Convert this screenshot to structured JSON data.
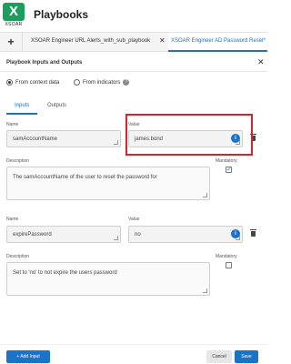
{
  "app": {
    "logo_letter": "X",
    "logo_text": "XSOAR",
    "title": "Playbooks",
    "brand_color": "#1d9e5f"
  },
  "tabs": {
    "add_label": "+",
    "items": [
      {
        "label": "XSOAR Engineer URL Alerts_with_sub_playbook",
        "close": "✕"
      },
      {
        "label": "XSOAR Engineer AD Password Reset*"
      }
    ]
  },
  "panel": {
    "title": "Playbook Inputs and Outputs",
    "close": "✕",
    "radio_context": "From context data",
    "radio_indicators": "From indicators",
    "help": "?",
    "subtab_inputs": "Inputs",
    "subtab_outputs": "Outputs"
  },
  "inputs": [
    {
      "name_label": "Name",
      "name": "samAccountName",
      "value_label": "Value",
      "value": "james.bond",
      "description_label": "Description",
      "description": "The samAccountName of the user to reset the password for",
      "mandatory_label": "Mandatory",
      "mandatory": true
    },
    {
      "name_label": "Name",
      "name": "expirePassword",
      "value_label": "Value",
      "value": "no",
      "description_label": "Description",
      "description": "Set to 'no' to not expire the users password",
      "mandatory_label": "Mandatory",
      "mandatory": false
    }
  ],
  "info_icon": "i",
  "footer": {
    "add_input": "+ Add Input",
    "cancel": "Cancel",
    "save": "Save"
  },
  "colors": {
    "accent": "#1a73c8",
    "highlight": "#d8232a"
  }
}
